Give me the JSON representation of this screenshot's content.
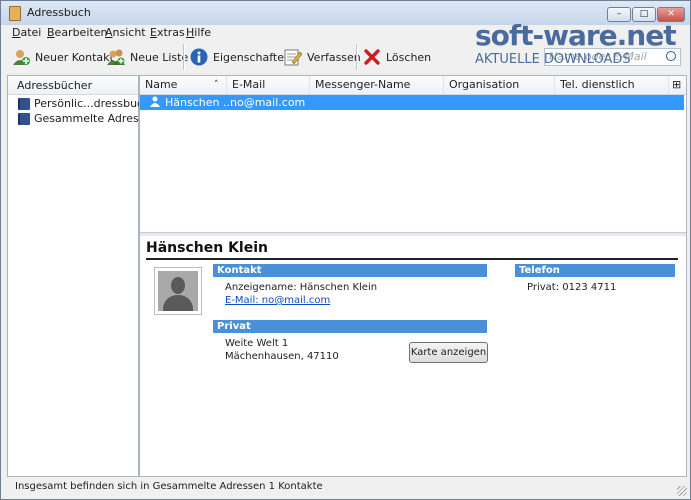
{
  "window": {
    "title": "Adressbuch",
    "minimize": "–",
    "maximize": "□",
    "close": "✕"
  },
  "menubar": [
    "Datei",
    "Bearbeiten",
    "Ansicht",
    "Extras",
    "Hilfe"
  ],
  "toolbar": {
    "new_contact": "Neuer Kontakt",
    "new_list": "Neue Liste",
    "properties": "Eigenschaften",
    "compose": "Verfassen",
    "delete": "Löschen"
  },
  "search": {
    "placeholder": "Name oder E-Mail"
  },
  "watermark": {
    "line1": "soft-ware.net",
    "line2": "AKTUELLE DOWNLOADS"
  },
  "address_books": {
    "header": "Adressbücher",
    "items": [
      {
        "label": "Persönlic...dressbuch"
      },
      {
        "label": "Gesammelte Adressen"
      }
    ]
  },
  "contact_list": {
    "columns": [
      "Name",
      "E-Mail",
      "Messenger-Name",
      "Organisation",
      "Tel. dienstlich"
    ],
    "sort_indicator": "˄",
    "picker_icon": "⊞",
    "rows": [
      {
        "name": "Hänschen ...",
        "email": "no@mail.com"
      }
    ]
  },
  "card": {
    "name": "Hänschen Klein",
    "contact_header": "Kontakt",
    "display_name": "Anzeigename: Hänschen Klein",
    "email": "E-Mail: no@mail.com",
    "private_header": "Privat",
    "street": "Weite Welt 1",
    "city": "Mächenhausen, 47110",
    "map_button": "Karte anzeigen",
    "phone_header": "Telefon",
    "phone": "Privat: 0123 4711"
  },
  "status": {
    "text": "Insgesamt befinden sich in Gesammelte Adressen 1 Kontakte"
  },
  "colors": {
    "selection": "#3399ff",
    "section_header": "#4a90d9",
    "link": "#0b4fc0"
  }
}
